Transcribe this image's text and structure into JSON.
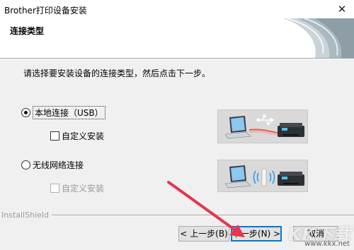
{
  "window": {
    "title": "Brother打印设备安装",
    "close_glyph": "✕"
  },
  "header": {
    "heading": "连接类型"
  },
  "prompt": "请选择要安装设备的连接类型，然后点击下一步。",
  "options": [
    {
      "label": "本地连接（USB）",
      "selected": true,
      "custom_install": {
        "label": "自定义安装",
        "checked": false,
        "enabled": true
      }
    },
    {
      "label": "无线网络连接",
      "selected": false,
      "custom_install": {
        "label": "自定义安装",
        "checked": false,
        "enabled": false
      }
    }
  ],
  "footer": {
    "brand": "InstallShield"
  },
  "buttons": {
    "back": "< 上一步(B)",
    "next": "下一步(N) >",
    "cancel": "取消"
  },
  "watermark": {
    "logo_text": "KK下载",
    "url": "www.kkx.net"
  },
  "colors": {
    "arrow": "#e8344e",
    "focus": "#0078d7",
    "cable": "#e53935"
  }
}
